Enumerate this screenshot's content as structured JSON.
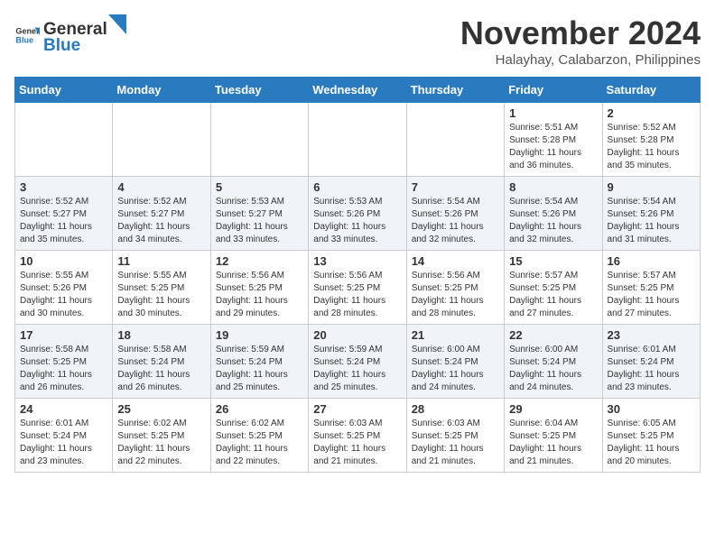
{
  "logo": {
    "text_general": "General",
    "text_blue": "Blue"
  },
  "title": {
    "month": "November 2024",
    "location": "Halayhay, Calabarzon, Philippines"
  },
  "headers": [
    "Sunday",
    "Monday",
    "Tuesday",
    "Wednesday",
    "Thursday",
    "Friday",
    "Saturday"
  ],
  "weeks": [
    [
      {
        "day": "",
        "info": ""
      },
      {
        "day": "",
        "info": ""
      },
      {
        "day": "",
        "info": ""
      },
      {
        "day": "",
        "info": ""
      },
      {
        "day": "",
        "info": ""
      },
      {
        "day": "1",
        "info": "Sunrise: 5:51 AM\nSunset: 5:28 PM\nDaylight: 11 hours and 36 minutes."
      },
      {
        "day": "2",
        "info": "Sunrise: 5:52 AM\nSunset: 5:28 PM\nDaylight: 11 hours and 35 minutes."
      }
    ],
    [
      {
        "day": "3",
        "info": "Sunrise: 5:52 AM\nSunset: 5:27 PM\nDaylight: 11 hours and 35 minutes."
      },
      {
        "day": "4",
        "info": "Sunrise: 5:52 AM\nSunset: 5:27 PM\nDaylight: 11 hours and 34 minutes."
      },
      {
        "day": "5",
        "info": "Sunrise: 5:53 AM\nSunset: 5:27 PM\nDaylight: 11 hours and 33 minutes."
      },
      {
        "day": "6",
        "info": "Sunrise: 5:53 AM\nSunset: 5:26 PM\nDaylight: 11 hours and 33 minutes."
      },
      {
        "day": "7",
        "info": "Sunrise: 5:54 AM\nSunset: 5:26 PM\nDaylight: 11 hours and 32 minutes."
      },
      {
        "day": "8",
        "info": "Sunrise: 5:54 AM\nSunset: 5:26 PM\nDaylight: 11 hours and 32 minutes."
      },
      {
        "day": "9",
        "info": "Sunrise: 5:54 AM\nSunset: 5:26 PM\nDaylight: 11 hours and 31 minutes."
      }
    ],
    [
      {
        "day": "10",
        "info": "Sunrise: 5:55 AM\nSunset: 5:26 PM\nDaylight: 11 hours and 30 minutes."
      },
      {
        "day": "11",
        "info": "Sunrise: 5:55 AM\nSunset: 5:25 PM\nDaylight: 11 hours and 30 minutes."
      },
      {
        "day": "12",
        "info": "Sunrise: 5:56 AM\nSunset: 5:25 PM\nDaylight: 11 hours and 29 minutes."
      },
      {
        "day": "13",
        "info": "Sunrise: 5:56 AM\nSunset: 5:25 PM\nDaylight: 11 hours and 28 minutes."
      },
      {
        "day": "14",
        "info": "Sunrise: 5:56 AM\nSunset: 5:25 PM\nDaylight: 11 hours and 28 minutes."
      },
      {
        "day": "15",
        "info": "Sunrise: 5:57 AM\nSunset: 5:25 PM\nDaylight: 11 hours and 27 minutes."
      },
      {
        "day": "16",
        "info": "Sunrise: 5:57 AM\nSunset: 5:25 PM\nDaylight: 11 hours and 27 minutes."
      }
    ],
    [
      {
        "day": "17",
        "info": "Sunrise: 5:58 AM\nSunset: 5:25 PM\nDaylight: 11 hours and 26 minutes."
      },
      {
        "day": "18",
        "info": "Sunrise: 5:58 AM\nSunset: 5:24 PM\nDaylight: 11 hours and 26 minutes."
      },
      {
        "day": "19",
        "info": "Sunrise: 5:59 AM\nSunset: 5:24 PM\nDaylight: 11 hours and 25 minutes."
      },
      {
        "day": "20",
        "info": "Sunrise: 5:59 AM\nSunset: 5:24 PM\nDaylight: 11 hours and 25 minutes."
      },
      {
        "day": "21",
        "info": "Sunrise: 6:00 AM\nSunset: 5:24 PM\nDaylight: 11 hours and 24 minutes."
      },
      {
        "day": "22",
        "info": "Sunrise: 6:00 AM\nSunset: 5:24 PM\nDaylight: 11 hours and 24 minutes."
      },
      {
        "day": "23",
        "info": "Sunrise: 6:01 AM\nSunset: 5:24 PM\nDaylight: 11 hours and 23 minutes."
      }
    ],
    [
      {
        "day": "24",
        "info": "Sunrise: 6:01 AM\nSunset: 5:24 PM\nDaylight: 11 hours and 23 minutes."
      },
      {
        "day": "25",
        "info": "Sunrise: 6:02 AM\nSunset: 5:25 PM\nDaylight: 11 hours and 22 minutes."
      },
      {
        "day": "26",
        "info": "Sunrise: 6:02 AM\nSunset: 5:25 PM\nDaylight: 11 hours and 22 minutes."
      },
      {
        "day": "27",
        "info": "Sunrise: 6:03 AM\nSunset: 5:25 PM\nDaylight: 11 hours and 21 minutes."
      },
      {
        "day": "28",
        "info": "Sunrise: 6:03 AM\nSunset: 5:25 PM\nDaylight: 11 hours and 21 minutes."
      },
      {
        "day": "29",
        "info": "Sunrise: 6:04 AM\nSunset: 5:25 PM\nDaylight: 11 hours and 21 minutes."
      },
      {
        "day": "30",
        "info": "Sunrise: 6:05 AM\nSunset: 5:25 PM\nDaylight: 11 hours and 20 minutes."
      }
    ]
  ]
}
